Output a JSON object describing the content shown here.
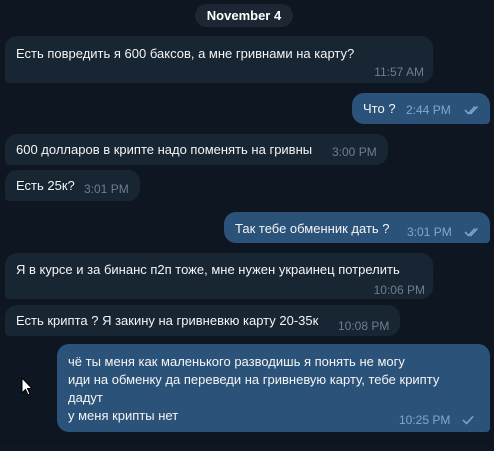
{
  "date_separator": "November 4",
  "colors": {
    "background": "#0e1621",
    "incoming": "#182533",
    "outgoing": "#2b5278",
    "time_in": "#6d7f8f",
    "time_out": "#7da8d3"
  },
  "messages": [
    {
      "dir": "in",
      "text": "Есть повредить я 600 баксов, а мне гривнами на карту?",
      "time": "11:57 AM"
    },
    {
      "dir": "out",
      "text": "Что ?",
      "time": "2:44 PM",
      "status": "read"
    },
    {
      "dir": "in",
      "text": "600 долларов в крипте надо поменять на гривны",
      "time": "3:00 PM"
    },
    {
      "dir": "in",
      "text": "Есть 25к?",
      "time": "3:01 PM"
    },
    {
      "dir": "out",
      "text": "Так тебе обменник дать ?",
      "time": "3:01 PM",
      "status": "read"
    },
    {
      "dir": "in",
      "text": "Я в курсе и за бинанс п2п тоже, мне нужен украинец потрелить",
      "time": "10:06 PM"
    },
    {
      "dir": "in",
      "text": "Есть крипта ? Я закину на гривневкю карту 20-35к",
      "time": "10:08 PM"
    },
    {
      "dir": "out",
      "lines": [
        "чё ты меня как маленького разводишь я понять не могу",
        "иди на обменку да переведи на гривневую карту, тебе крипту",
        "дадут",
        "у меня крипты нет"
      ],
      "time": "10:25 PM",
      "status": "sent"
    }
  ],
  "icons": {
    "read": "double-check-icon",
    "sent": "single-check-icon",
    "cursor": "mouse-pointer-icon"
  }
}
